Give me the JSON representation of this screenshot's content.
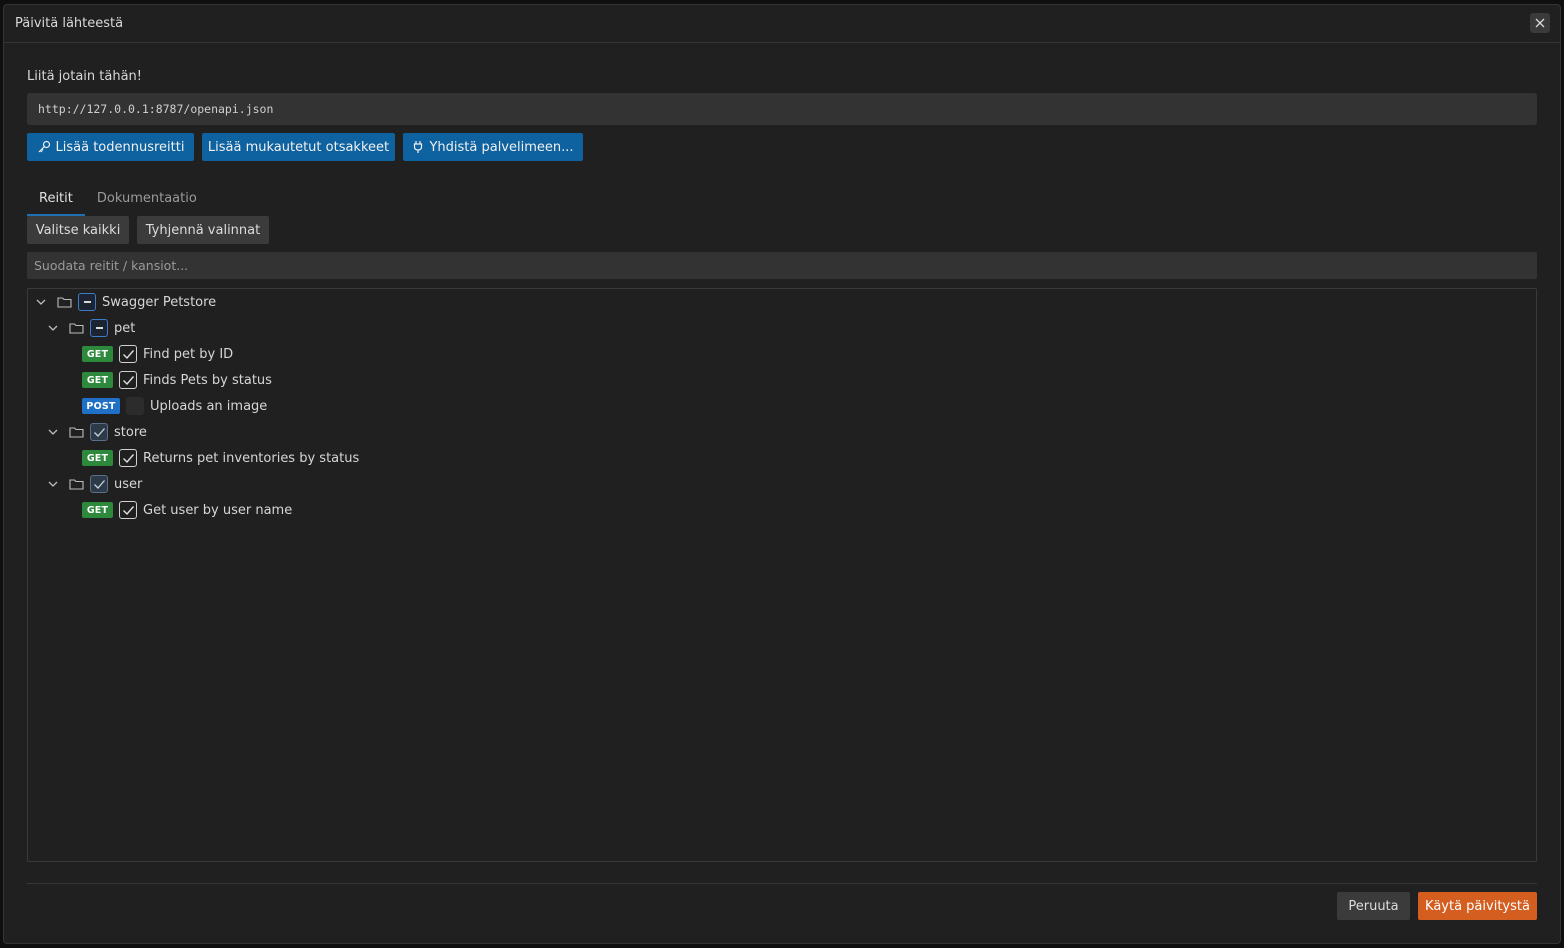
{
  "dialog": {
    "title": "Päivitä lähteestä",
    "paste_label": "Liitä jotain tähän!",
    "url_value": "http://127.0.0.1:8787/openapi.json"
  },
  "actions": {
    "auth_route": "Lisää todennusreitti",
    "custom_headers": "Lisää mukautetut otsakkeet",
    "connect_server": "Yhdistä palvelimeen..."
  },
  "tabs": [
    {
      "label": "Reitit",
      "active": true
    },
    {
      "label": "Dokumentaatio",
      "active": false
    }
  ],
  "selection": {
    "select_all": "Valitse kaikki",
    "clear": "Tyhjennä valinnat"
  },
  "filter": {
    "placeholder": "Suodata reitit / kansiot..."
  },
  "tree": {
    "root": {
      "label": "Swagger Petstore",
      "state": "partial"
    },
    "folders": [
      {
        "label": "pet",
        "state": "partial",
        "routes": [
          {
            "method": "GET",
            "label": "Find pet by ID",
            "checked": true
          },
          {
            "method": "GET",
            "label": "Finds Pets by status",
            "checked": true
          },
          {
            "method": "POST",
            "label": "Uploads an image",
            "checked": false
          }
        ]
      },
      {
        "label": "store",
        "state": "checked",
        "routes": [
          {
            "method": "GET",
            "label": "Returns pet inventories by status",
            "checked": true
          }
        ]
      },
      {
        "label": "user",
        "state": "checked",
        "routes": [
          {
            "method": "GET",
            "label": "Get user by user name",
            "checked": true
          }
        ]
      }
    ]
  },
  "footer": {
    "cancel": "Peruuta",
    "apply": "Käytä päivitystä"
  },
  "colors": {
    "primary_blue": "#0e62a0",
    "apply_orange": "#d35e1f",
    "get_badge": "#2d8a3d",
    "post_badge": "#1f70c6"
  }
}
